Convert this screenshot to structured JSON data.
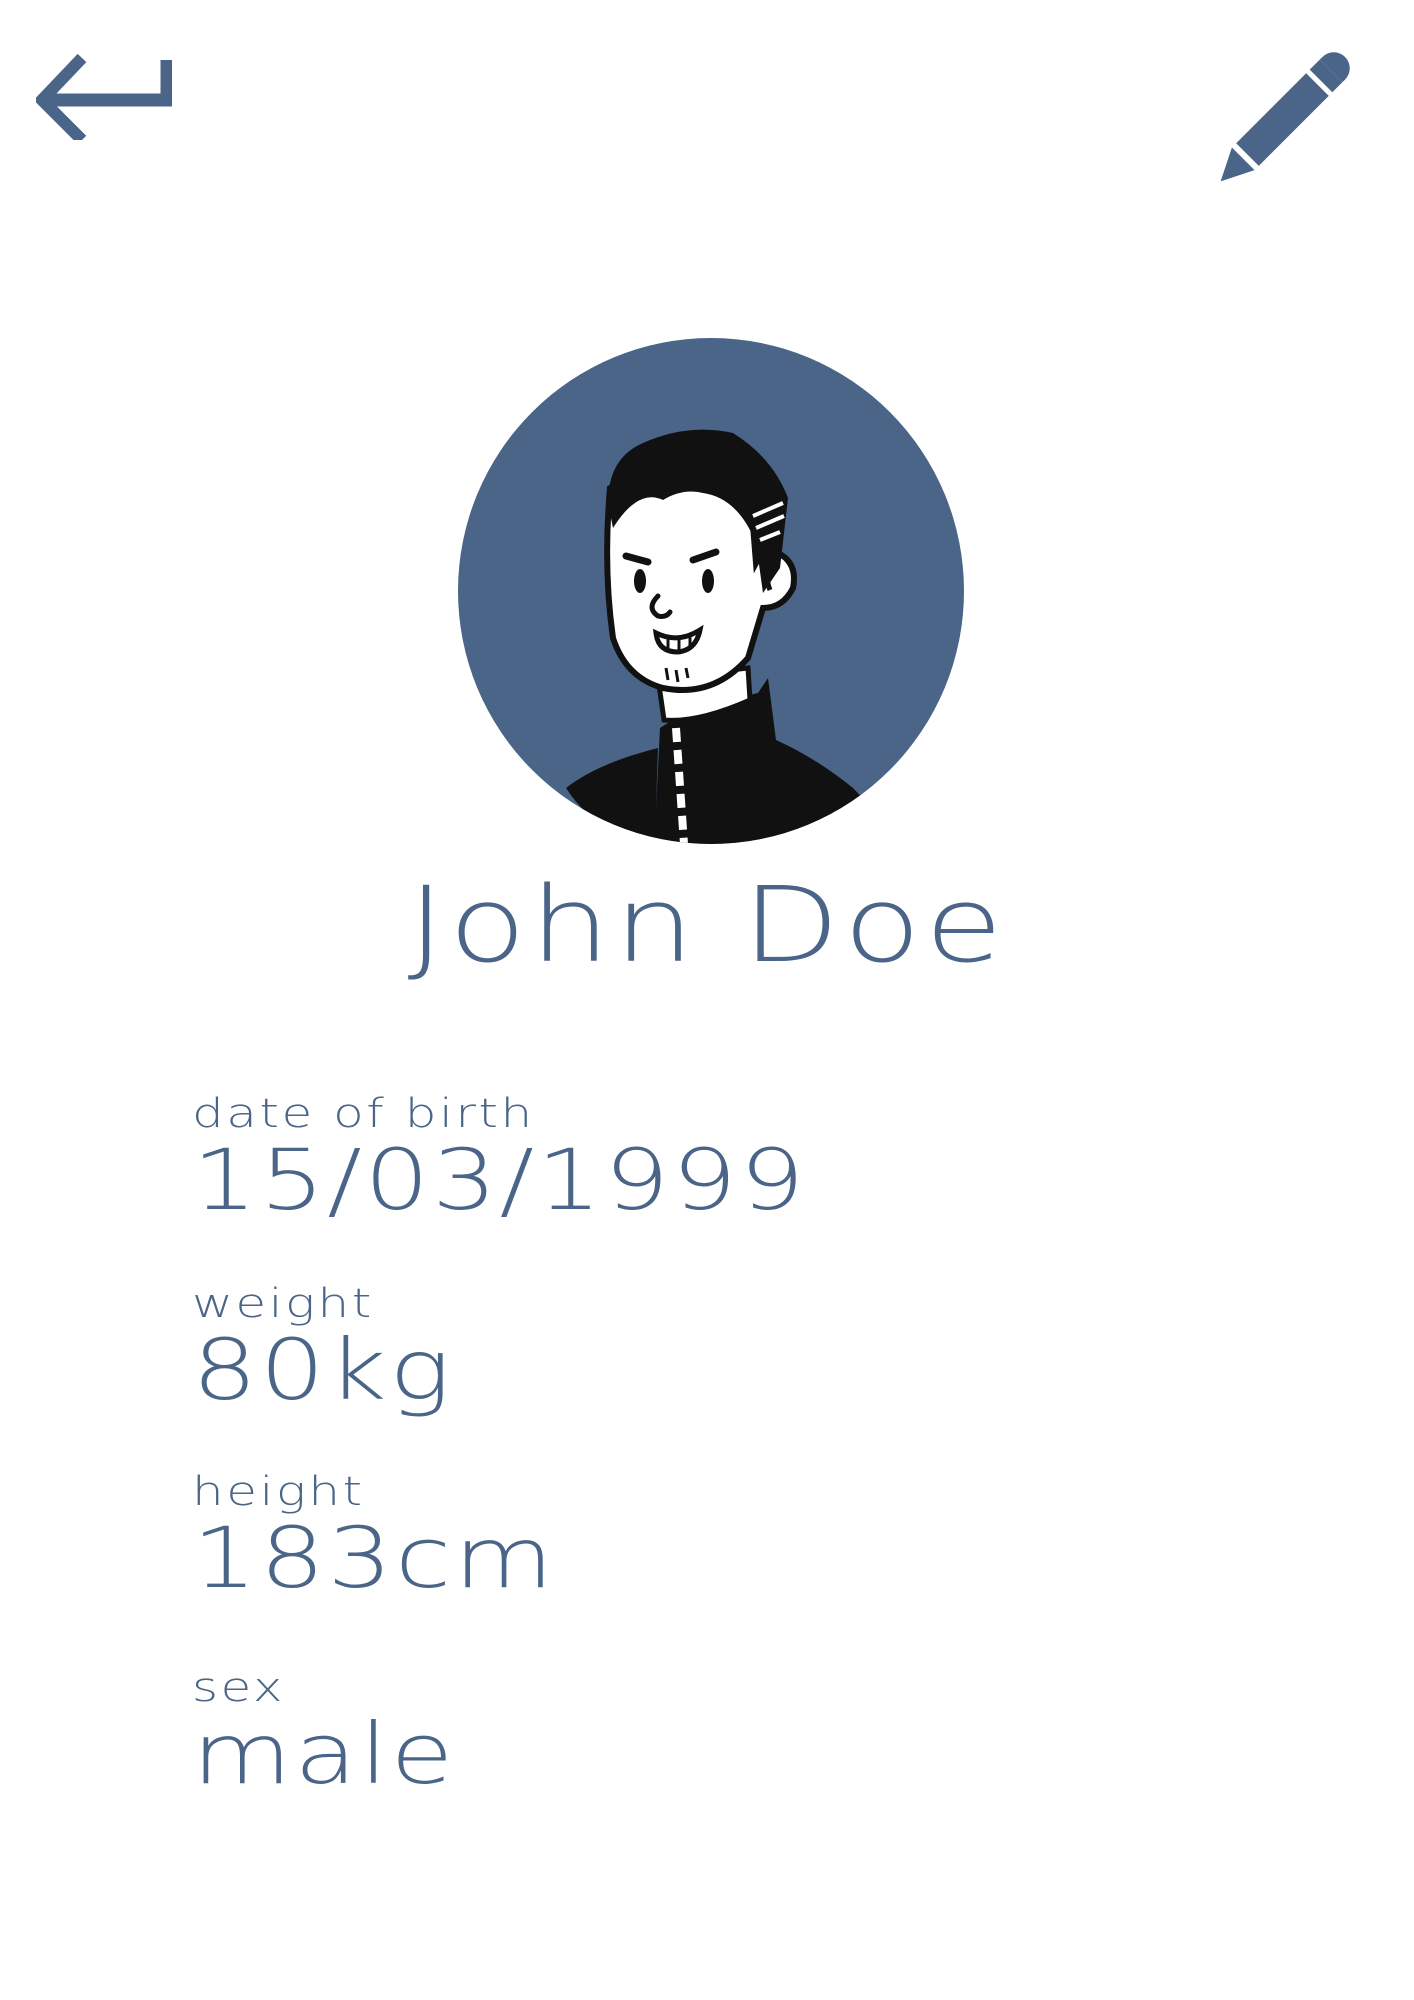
{
  "header": {
    "back_icon": "return-arrow-icon",
    "edit_icon": "pencil-icon"
  },
  "profile": {
    "avatar": "cartoon-man-portrait",
    "name": "John Doe",
    "fields": [
      {
        "label": "date of birth",
        "value": "15/03/1999"
      },
      {
        "label": "weight",
        "value": "80kg"
      },
      {
        "label": "height",
        "value": "183cm"
      },
      {
        "label": "sex",
        "value": "male"
      }
    ]
  },
  "colors": {
    "accent": "#4a6588",
    "background": "#ffffff",
    "ink": "#111111"
  }
}
